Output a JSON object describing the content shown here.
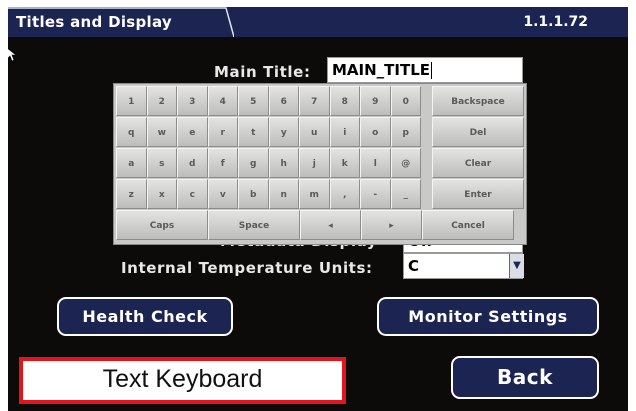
{
  "header": {
    "title": "Titles and Display",
    "version": "1.1.1.72"
  },
  "form": {
    "main_title_label": "Main Title:",
    "main_title_value": "MAIN_TITLE",
    "hidden_row_label": "Metadata Display",
    "hidden_row_value": "Off",
    "temp_units_label": "Internal Temperature Units:",
    "temp_units_value": "C"
  },
  "keyboard": {
    "rows": [
      [
        "1",
        "2",
        "3",
        "4",
        "5",
        "6",
        "7",
        "8",
        "9",
        "0",
        "Backspace"
      ],
      [
        "q",
        "w",
        "e",
        "r",
        "t",
        "y",
        "u",
        "i",
        "o",
        "p",
        "Del"
      ],
      [
        "a",
        "s",
        "d",
        "f",
        "g",
        "h",
        "j",
        "k",
        "l",
        "@",
        "Clear"
      ],
      [
        "z",
        "x",
        "c",
        "v",
        "b",
        "n",
        "m",
        ",",
        "-",
        "_",
        "Enter"
      ],
      [
        "Caps",
        "Space",
        "◂",
        "▸",
        "Cancel"
      ]
    ]
  },
  "buttons": {
    "health_check": "Health Check",
    "monitor_settings": "Monitor Settings",
    "back": "Back"
  },
  "caption": "Text Keyboard",
  "colors": {
    "accent": "#1c2451",
    "caption_border": "#e4141c",
    "screen_bg": "#0c0b09"
  },
  "icons": [
    "mouse-pointer-icon",
    "dropdown-arrow-icon"
  ]
}
